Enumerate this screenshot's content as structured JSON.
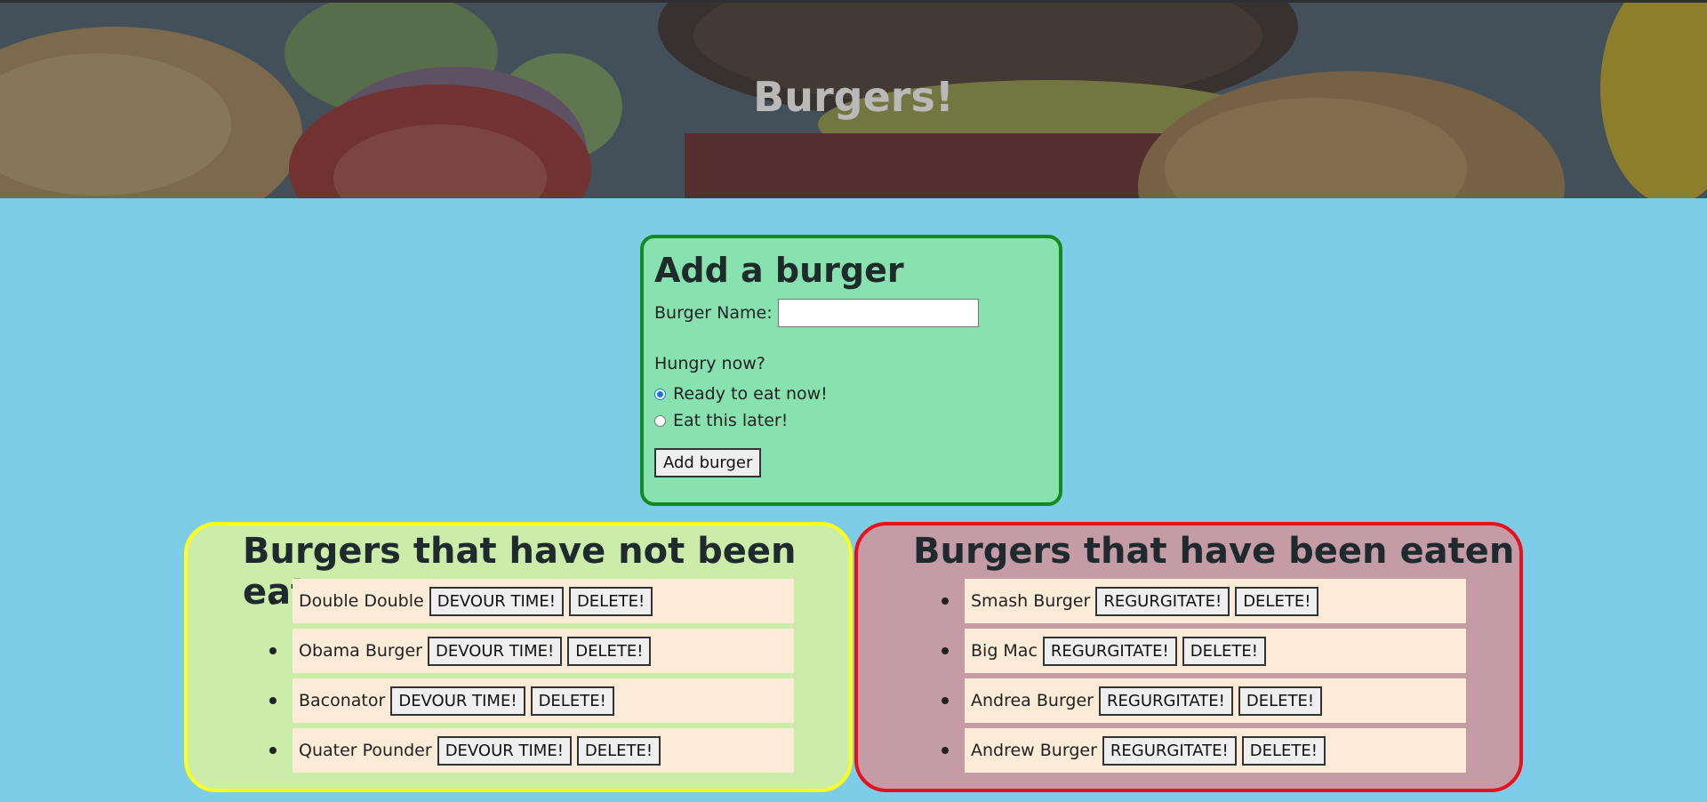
{
  "header": {
    "title": "Burgers!"
  },
  "add_form": {
    "title": "Add a burger",
    "name_label": "Burger Name:",
    "name_value": "",
    "hungry_label": "Hungry now?",
    "options": [
      {
        "label": "Ready to eat now!",
        "checked": true
      },
      {
        "label": "Eat this later!",
        "checked": false
      }
    ],
    "submit_label": "Add burger"
  },
  "not_eaten": {
    "title": "Burgers that have not been eaten",
    "action_label": "DEVOUR TIME!",
    "delete_label": "DELETE!",
    "items": [
      "Double Double",
      "Obama Burger",
      "Baconator",
      "Quater Pounder"
    ]
  },
  "eaten": {
    "title": "Burgers that have been eaten",
    "action_label": "REGURGITATE!",
    "delete_label": "DELETE!",
    "items": [
      "Smash Burger",
      "Big Mac",
      "Andrea Burger",
      "Andrew Burger"
    ]
  },
  "colors": {
    "page_bg": "#7ecde8",
    "add_box_bg": "#87e2b0",
    "add_box_border": "#138a20",
    "not_eaten_bg": "#ccecaa",
    "not_eaten_border": "#ffff1a",
    "eaten_bg": "#c59ba6",
    "eaten_border": "#e8101a",
    "item_bg": "#fbebd7"
  }
}
